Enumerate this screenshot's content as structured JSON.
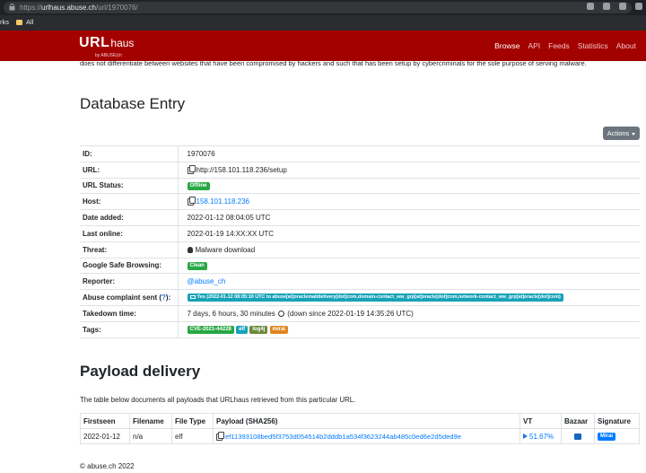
{
  "browser": {
    "url_prefix": "https://",
    "url_host": "urlhaus.abuse.ch",
    "url_path": "/url/1970076/",
    "bookmark_partial": "rks",
    "bookmark_all": "All"
  },
  "navbar": {
    "brand_main": "URL",
    "brand_sub": "haus",
    "brand_tag": "by ABUSE|ch",
    "items": [
      "Browse",
      "API",
      "Feeds",
      "Statistics",
      "About"
    ]
  },
  "intro_text": "does not differentiate between websites that have been compromised by hackers and such that has been setup by cybercriminals for the sole purpose of serving malware.",
  "entry": {
    "heading": "Database Entry",
    "actions_label": "Actions",
    "labels": {
      "id": "ID:",
      "url": "URL:",
      "url_status": "URL Status:",
      "host": "Host:",
      "date_added": "Date added:",
      "last_online": "Last online:",
      "threat": "Threat:",
      "gsb": "Google Safe Browsing:",
      "reporter": "Reporter:",
      "abuse": "Abuse complaint sent (",
      "abuse_q": "?",
      "abuse_end": "):",
      "takedown": "Takedown time:",
      "tags": "Tags:"
    },
    "values": {
      "id": "1970076",
      "url": "http://158.101.118.236/setup",
      "url_status": "Offline",
      "host": "158.101.118.236",
      "date_added": "2022-01-12 08:04:05 UTC",
      "last_online": "2022-01-19 14:XX:XX UTC",
      "threat": "Malware download",
      "gsb": "Clean",
      "reporter": "@abuse_ch",
      "abuse": "Yes (2022-01-12 08:05:10 UTC to abuse[at]oraclemaildelivery[dot]com,domain-contact_ww_grp[at]oracle[dot]com,network-contact_ww_grp[at]oracle[dot]com)",
      "takedown_main": "7 days, 6 hours, 30 minutes",
      "takedown_since": "(down since 2022-01-19 14:35:26 UTC)",
      "tags": [
        "CVE-2021-44228",
        "elf",
        "log4j",
        "mirai"
      ]
    }
  },
  "payload": {
    "heading": "Payload delivery",
    "description": "The table below documents all payloads that URLhaus retrieved from this particular URL.",
    "columns": [
      "Firstseen",
      "Filename",
      "File Type",
      "Payload (SHA256)",
      "VT",
      "Bazaar",
      "Signature"
    ],
    "rows": [
      {
        "firstseen": "2022-01-12",
        "filename": "n/a",
        "filetype": "elf",
        "sha256": "ef11393108bed5f3753d054514b2dddb1a534f3623244ab485c0ed6e2d5ded9e",
        "vt": "51.67%",
        "signature": "Mirai"
      }
    ]
  },
  "footer": "© abuse.ch 2022",
  "colors": {
    "navbar": "#a30000",
    "link": "#007bff",
    "success": "#28a745",
    "info": "#17a2b8",
    "secondary": "#6c757d"
  }
}
